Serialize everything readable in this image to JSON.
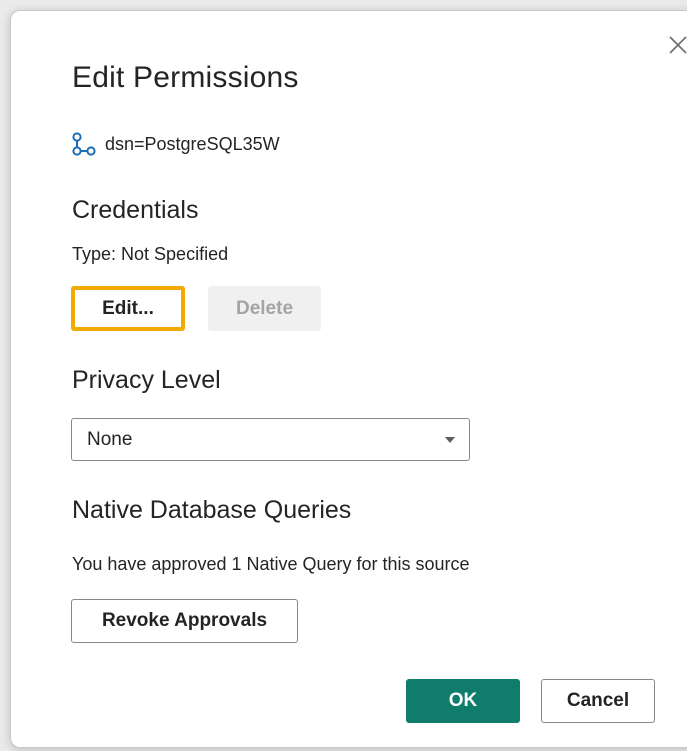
{
  "dialog": {
    "title": "Edit Permissions",
    "close_icon": "close-icon"
  },
  "source": {
    "icon": "dsn-connection-icon",
    "text": "dsn=PostgreSQL35W",
    "icon_color": "#1f6fb5"
  },
  "credentials": {
    "heading": "Credentials",
    "type_text": "Type: Not Specified",
    "edit_label": "Edit...",
    "delete_label": "Delete",
    "focus_color": "#f2a900"
  },
  "privacy": {
    "heading": "Privacy Level",
    "selected": "None"
  },
  "native_queries": {
    "heading": "Native Database Queries",
    "status_text": "You have approved 1 Native Query for this source",
    "revoke_label": "Revoke Approvals"
  },
  "footer": {
    "ok_label": "OK",
    "cancel_label": "Cancel",
    "primary_color": "#107c6c"
  }
}
